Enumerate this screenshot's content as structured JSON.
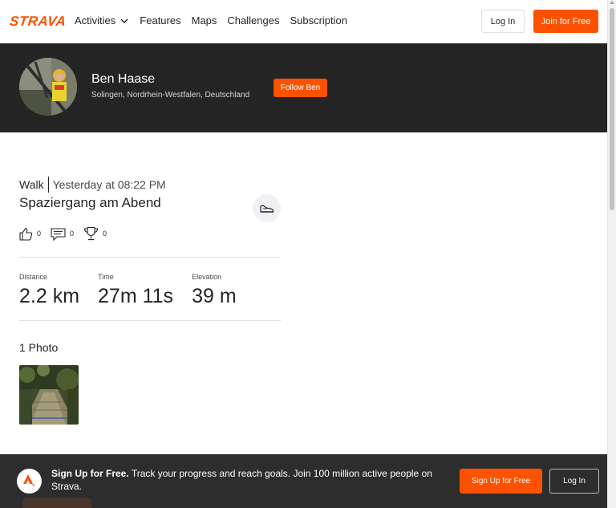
{
  "nav": {
    "logo": "STRAVA",
    "items": [
      "Activities",
      "Features",
      "Maps",
      "Challenges",
      "Subscription"
    ],
    "login": "Log In",
    "join": "Join for Free"
  },
  "athlete": {
    "name": "Ben Haase",
    "location": "Solingen, Nordrhein-Westfalen, Deutschland",
    "follow": "Follow Ben"
  },
  "activity": {
    "type": "Walk",
    "time": "Yesterday at 08:22 PM",
    "title": "Spaziergang am Abend",
    "kudos": "0",
    "comments": "0",
    "achievements": "0",
    "stats": [
      {
        "label": "Distance",
        "value": "2.2 km"
      },
      {
        "label": "Time",
        "value": "27m 11s"
      },
      {
        "label": "Elevation",
        "value": "39 m"
      }
    ],
    "photos_title": "1 Photo"
  },
  "banner": {
    "headline": "Sign Up for Free.",
    "text": "Track your progress and reach goals. Join 100 million active people on Strava.",
    "signup": "Sign Up for Free",
    "login": "Log In"
  },
  "colors": {
    "brand": "#fc5200",
    "header_bg": "#242424",
    "banner_bg": "#2d2d2d"
  }
}
